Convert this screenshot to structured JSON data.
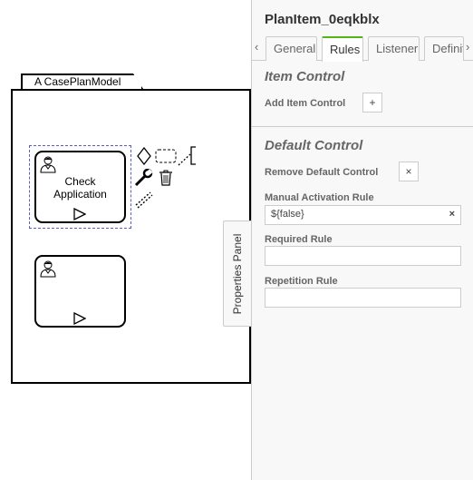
{
  "canvas": {
    "case_plan_model_label": "A CasePlanModel",
    "tasks": [
      {
        "label": "Check\nApplication"
      },
      {
        "label": ""
      }
    ]
  },
  "properties_toggle": {
    "label": "Properties Panel"
  },
  "panel": {
    "title": "PlanItem_0eqkblx",
    "tabs": [
      {
        "label": "General"
      },
      {
        "label": "Rules",
        "active": true
      },
      {
        "label": "Listener"
      },
      {
        "label": "Definit"
      }
    ],
    "tab_prev": "‹",
    "tab_next": "›",
    "item_control": {
      "title": "Item Control",
      "add_label": "Add Item Control",
      "add_button": "+"
    },
    "default_control": {
      "title": "Default Control",
      "remove_label": "Remove Default Control",
      "remove_button": "×",
      "manual_activation_label": "Manual Activation Rule",
      "manual_activation_value": "${false}",
      "clear_button": "×",
      "required_label": "Required Rule",
      "required_value": "",
      "repetition_label": "Repetition Rule",
      "repetition_value": ""
    }
  },
  "colors": {
    "active_tab_accent": "#52b415",
    "selection": "#5c5cc8"
  }
}
